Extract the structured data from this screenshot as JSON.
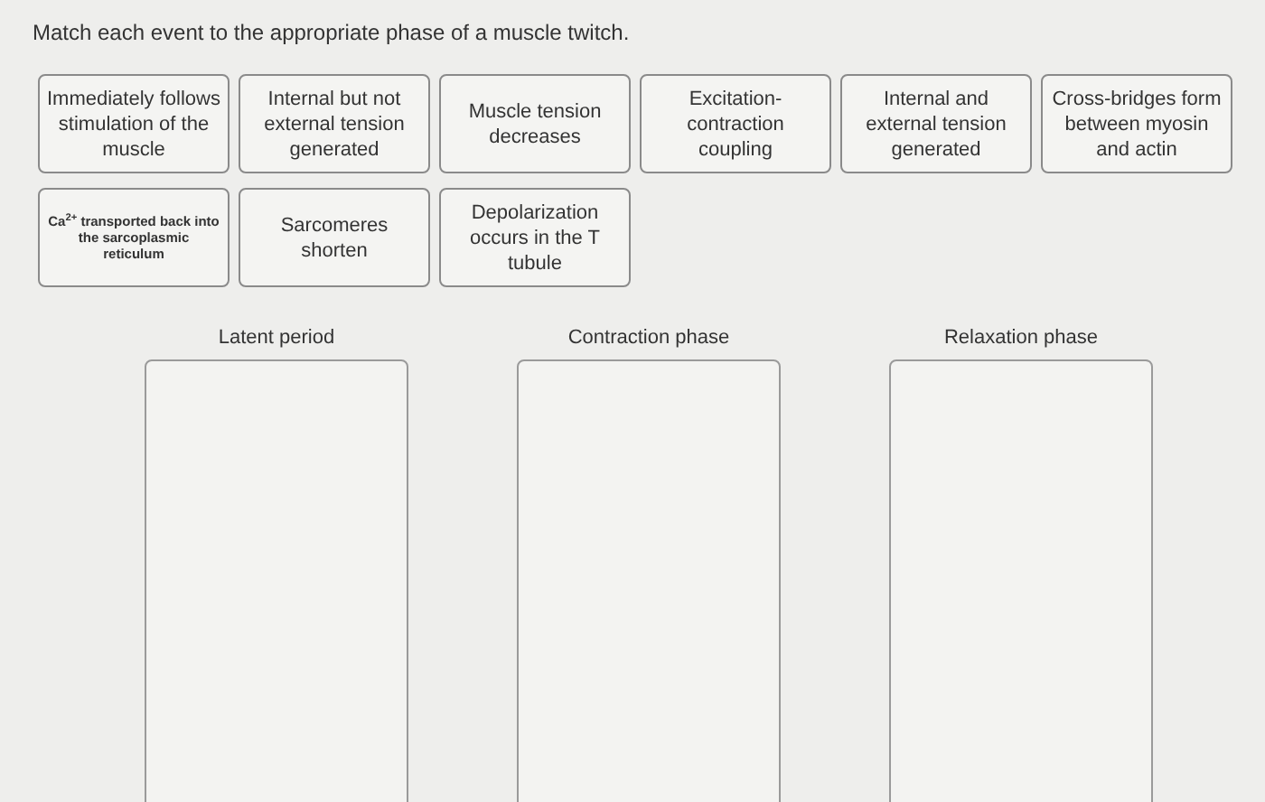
{
  "instruction": "Match each event to the appropriate phase of a muscle twitch.",
  "cards": [
    [
      {
        "text": "Immediately follows stimulation of the muscle",
        "kind": "normal"
      },
      {
        "text": "Internal but not external tension generated",
        "kind": "normal"
      },
      {
        "text": "Muscle tension decreases",
        "kind": "normal"
      },
      {
        "text": "Excitation-contraction coupling",
        "kind": "normal"
      },
      {
        "text": "Internal and external tension generated",
        "kind": "normal"
      },
      {
        "text": "Cross-bridges form between myosin and actin",
        "kind": "normal"
      }
    ],
    [
      {
        "text": "Ca$^{2+}$ transported back into the sarcoplasmic reticulum",
        "kind": "small"
      },
      {
        "text": "Sarcomeres shorten",
        "kind": "normal"
      },
      {
        "text": "Depolarization occurs in the T tubule",
        "kind": "normal"
      }
    ]
  ],
  "phases": [
    {
      "label": "Latent period"
    },
    {
      "label": "Contraction phase"
    },
    {
      "label": "Relaxation phase"
    }
  ]
}
